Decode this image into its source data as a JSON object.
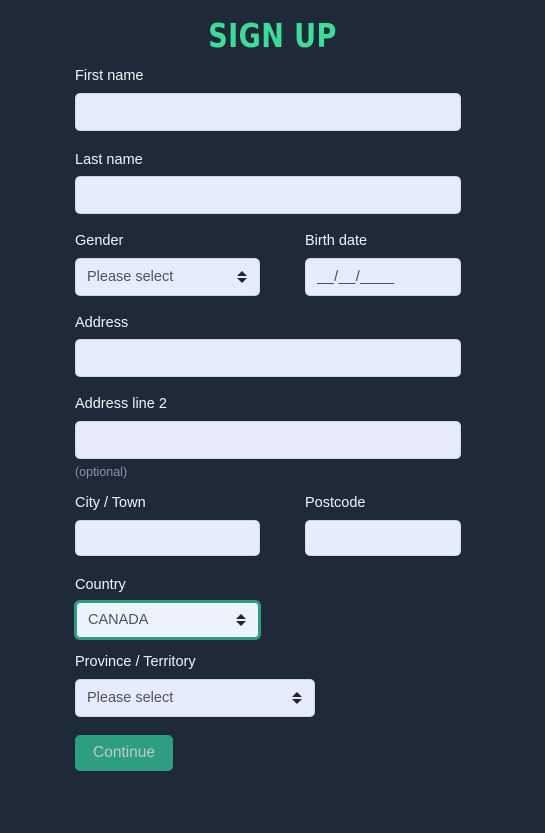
{
  "form": {
    "title": "SIGN UP",
    "fields": {
      "first_name": {
        "label": "First name",
        "value": "",
        "placeholder": ""
      },
      "last_name": {
        "label": "Last name",
        "value": "",
        "placeholder": ""
      },
      "gender": {
        "label": "Gender",
        "selected": "Please select"
      },
      "birth_date": {
        "label": "Birth date",
        "value": "__/__/____",
        "placeholder": "__/__/____"
      },
      "address": {
        "label": "Address",
        "value": "",
        "placeholder": ""
      },
      "address_line_2": {
        "label": "Address line 2",
        "value": "",
        "placeholder": "",
        "helper": "(optional)"
      },
      "city": {
        "label": "City / Town",
        "value": "",
        "placeholder": ""
      },
      "postcode": {
        "label": "Postcode",
        "value": "",
        "placeholder": ""
      },
      "country": {
        "label": "Country",
        "selected": "CANADA"
      },
      "province": {
        "label": "Province / Territory",
        "selected": "Please select"
      }
    },
    "submit": {
      "label": "Continue"
    }
  },
  "colors": {
    "background": "#1e2a38",
    "title_accent": "#3ddc97",
    "input_fill": "#e7ecfa",
    "label_text": "#eef1f5",
    "helper_text": "#8b95a6",
    "focus_ring": "#2e9e82",
    "button_fill": "#2e9e82",
    "button_text": "#bfc7d0"
  }
}
